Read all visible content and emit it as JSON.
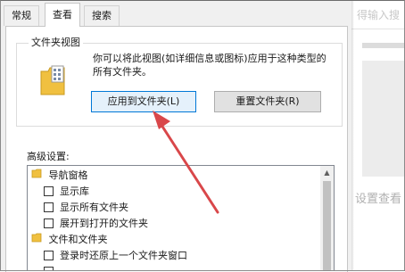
{
  "dialog": {
    "tabs": [
      {
        "label": "常规"
      },
      {
        "label": "查看"
      },
      {
        "label": "搜索"
      }
    ],
    "folder_views": {
      "title": "文件夹视图",
      "description": "你可以将此视图(如详细信息或图标)应用于这种类型的所有文件夹。",
      "apply_button": "应用到文件夹(L)",
      "reset_button": "重置文件夹(R)"
    },
    "advanced": {
      "label": "高级设置:",
      "items": [
        {
          "label": "导航窗格",
          "type": "folder-header"
        },
        {
          "label": "显示库",
          "type": "checkbox"
        },
        {
          "label": "显示所有文件夹",
          "type": "checkbox"
        },
        {
          "label": "展开到打开的文件夹",
          "type": "checkbox"
        },
        {
          "label": "文件和文件夹",
          "type": "folder-header"
        },
        {
          "label": "登录时还原上一个文件夹窗口",
          "type": "checkbox"
        }
      ]
    }
  },
  "background_window": {
    "text_top": "得输入搜",
    "text_middle": "设置查看"
  },
  "colors": {
    "accent_blue": "#0078d7",
    "arrow_red": "#d9474a",
    "folder_yellow": "#f0c040"
  }
}
